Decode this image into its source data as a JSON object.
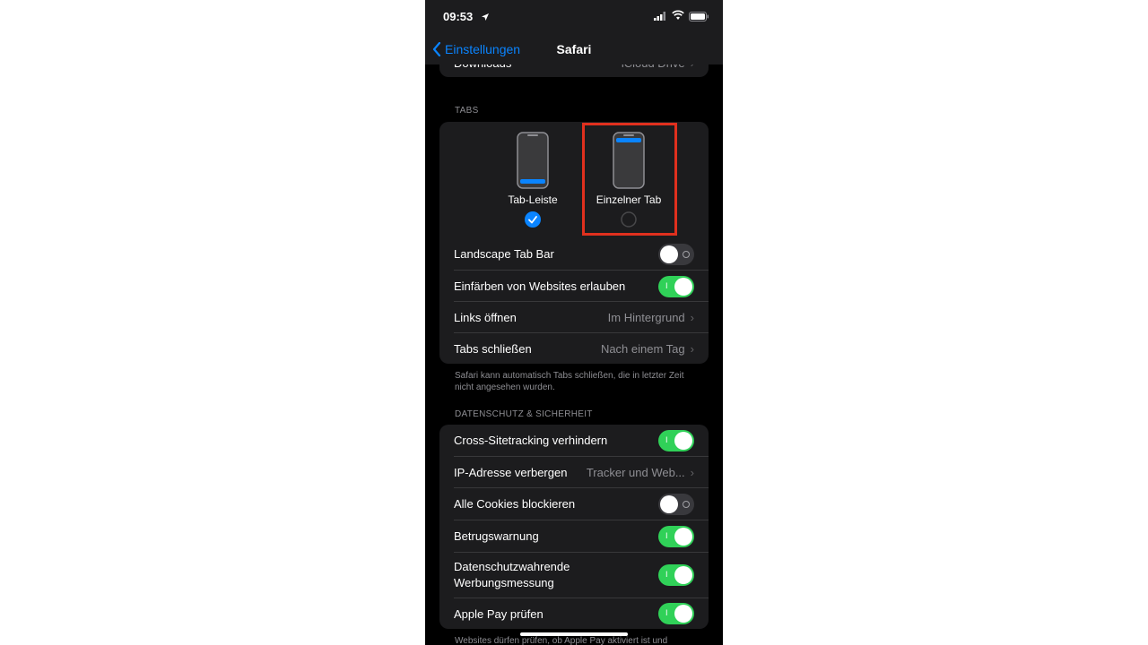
{
  "status": {
    "time": "09:53"
  },
  "nav": {
    "back_label": "Einstellungen",
    "title": "Safari"
  },
  "top_card": {
    "label": "Downloads",
    "value": "iCloud Drive"
  },
  "tabs_section": {
    "header": "TABS",
    "options": [
      {
        "label": "Tab-Leiste",
        "selected": true
      },
      {
        "label": "Einzelner Tab",
        "selected": false
      }
    ],
    "rows": [
      {
        "label": "Landscape Tab Bar",
        "toggle": false
      },
      {
        "label": "Einfärben von Websites erlauben",
        "toggle": true
      },
      {
        "label": "Links öffnen",
        "value": "Im Hintergrund"
      },
      {
        "label": "Tabs schließen",
        "value": "Nach einem Tag"
      }
    ],
    "footer": "Safari kann automatisch Tabs schließen, die in letzter Zeit nicht angesehen wurden."
  },
  "privacy_section": {
    "header": "DATENSCHUTZ & SICHERHEIT",
    "rows": [
      {
        "label": "Cross-Sitetracking verhindern",
        "toggle": true
      },
      {
        "label": "IP-Adresse verbergen",
        "value": "Tracker und Web..."
      },
      {
        "label": "Alle Cookies blockieren",
        "toggle": false
      },
      {
        "label": "Betrugswarnung",
        "toggle": true
      },
      {
        "label_line1": "Datenschutzwahrende",
        "label_line2": "Werbungsmessung",
        "toggle": true
      },
      {
        "label": "Apple Pay prüfen",
        "toggle": true
      }
    ],
    "footer": "Websites dürfen prüfen, ob Apple Pay aktiviert ist und"
  },
  "colors": {
    "accent": "#0a84ff",
    "toggle_on": "#30d158",
    "highlight": "#e0301e",
    "card": "#1c1c1e"
  }
}
